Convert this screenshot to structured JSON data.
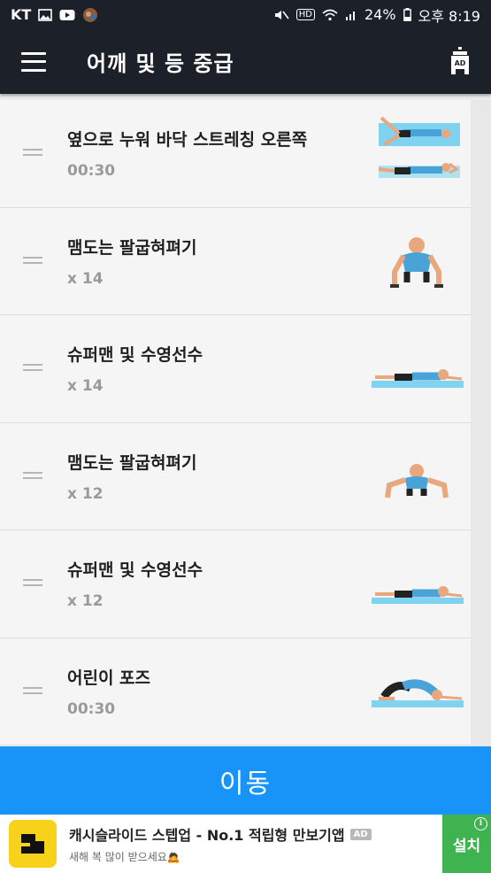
{
  "status_bar": {
    "carrier": "KT",
    "battery": "24%",
    "time": "오후 8:19",
    "left_icons": [
      "gallery-icon",
      "youtube-icon",
      "avatar-notification-icon"
    ],
    "right_icons": [
      "mute-vibrate-icon",
      "hd-voice-icon",
      "wifi-icon",
      "signal-icon",
      "battery-icon"
    ],
    "hd_label": "HD"
  },
  "app_bar": {
    "title": "어깨 및 등 중급",
    "menu_icon": "hamburger-menu-icon",
    "remove_ads_icon": "remove-ads-icon",
    "remove_ads_label": "AD"
  },
  "exercises": [
    {
      "name": "옆으로 누워 바닥 스트레칭 오른쪽",
      "meta": "00:30",
      "thumb": "side-lying-stretch"
    },
    {
      "name": "맴도는 팔굽혀펴기",
      "meta": "x 14",
      "thumb": "pushup"
    },
    {
      "name": "슈퍼맨 및 수영선수",
      "meta": "x 14",
      "thumb": "superman"
    },
    {
      "name": "맴도는 팔굽혀펴기",
      "meta": "x 12",
      "thumb": "pushup"
    },
    {
      "name": "슈퍼맨 및 수영선수",
      "meta": "x 12",
      "thumb": "superman"
    },
    {
      "name": "어린이 포즈",
      "meta": "00:30",
      "thumb": "child-pose"
    }
  ],
  "go_button": {
    "label": "이동"
  },
  "ad": {
    "title": "캐시슬라이드 스텝업 - No.1 적립형 만보기앱",
    "tag": "AD",
    "subtitle": "새해 복 많이 받으세요🙇",
    "install_label": "설치",
    "info": "i"
  },
  "colors": {
    "header_bg": "#1b2029",
    "accent_blue": "#1893f8",
    "install_green": "#3fb34f",
    "mat_blue": "#7fd3f0"
  }
}
